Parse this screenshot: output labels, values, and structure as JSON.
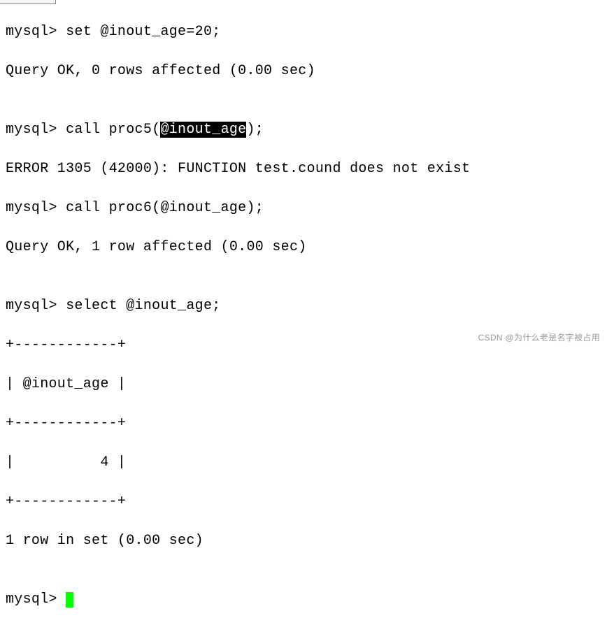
{
  "prompt": "mysql> ",
  "lines": {
    "l1_cmd": "set @inout_age=20;",
    "l2": "Query OK, 0 rows affected (0.00 sec)",
    "l3": "",
    "l4_pre": "call proc5(",
    "l4_hl": "@inout_age",
    "l4_post": ");",
    "l5": "ERROR 1305 (42000): FUNCTION test.cound does not exist",
    "l6_cmd": "call proc6(@inout_age);",
    "l7": "Query OK, 1 row affected (0.00 sec)",
    "l8": "",
    "l9_cmd": "select @inout_age;",
    "l10": "+------------+",
    "l11": "| @inout_age |",
    "l12": "+------------+",
    "l13": "|          4 |",
    "l14": "+------------+",
    "l15": "1 row in set (0.00 sec)",
    "l16": ""
  },
  "chart_data": {
    "type": "table",
    "title": "select @inout_age",
    "columns": [
      "@inout_age"
    ],
    "rows": [
      [
        4
      ]
    ]
  },
  "watermark": "CSDN @为什么老是名字被占用"
}
